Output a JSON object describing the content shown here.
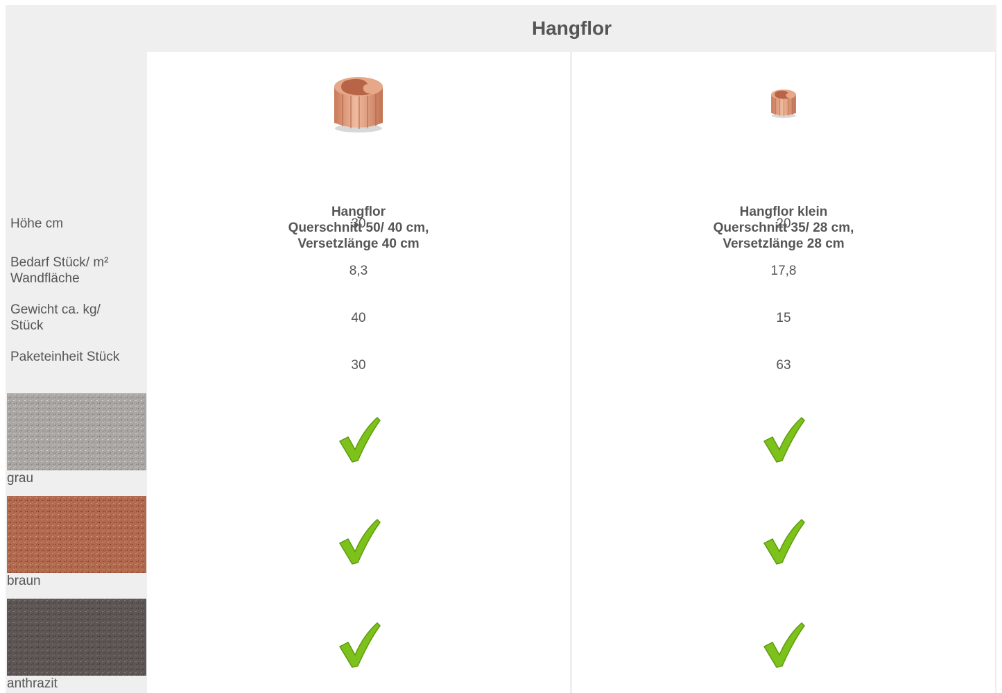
{
  "header": {
    "title": "Hangflor"
  },
  "products": [
    {
      "name": "Hangflor",
      "line2": "Querschnitt 50/ 40 cm,",
      "line3": "Versetzlänge 40 cm",
      "icon": "large-planter-stone-icon",
      "values": [
        "30",
        "8,3",
        "40",
        "30"
      ]
    },
    {
      "name": "Hangflor klein",
      "line2": "Querschnitt 35/ 28 cm,",
      "line3": "Versetzlänge 28 cm",
      "icon": "small-planter-stone-icon",
      "values": [
        "20",
        "17,8",
        "15",
        "63"
      ]
    }
  ],
  "rows": [
    {
      "label1": "Höhe cm",
      "label2": ""
    },
    {
      "label1": "Bedarf Stück/ m²",
      "label2": "Wandfläche"
    },
    {
      "label1": "Gewicht ca. kg/",
      "label2": "Stück"
    },
    {
      "label1": "Paketeinheit Stück",
      "label2": ""
    }
  ],
  "colors": [
    {
      "name": "grau",
      "swatch_color": "#a9a6a4",
      "available": [
        true,
        true
      ]
    },
    {
      "name": "braun",
      "swatch_color": "#b26a4e",
      "available": [
        true,
        true
      ]
    },
    {
      "name": "anthrazit",
      "swatch_color": "#5d5655",
      "available": [
        true,
        true
      ]
    }
  ],
  "theme": {
    "background": "#efefef",
    "check_color": "#7dc21a",
    "stone_color": "#e0a07e"
  }
}
